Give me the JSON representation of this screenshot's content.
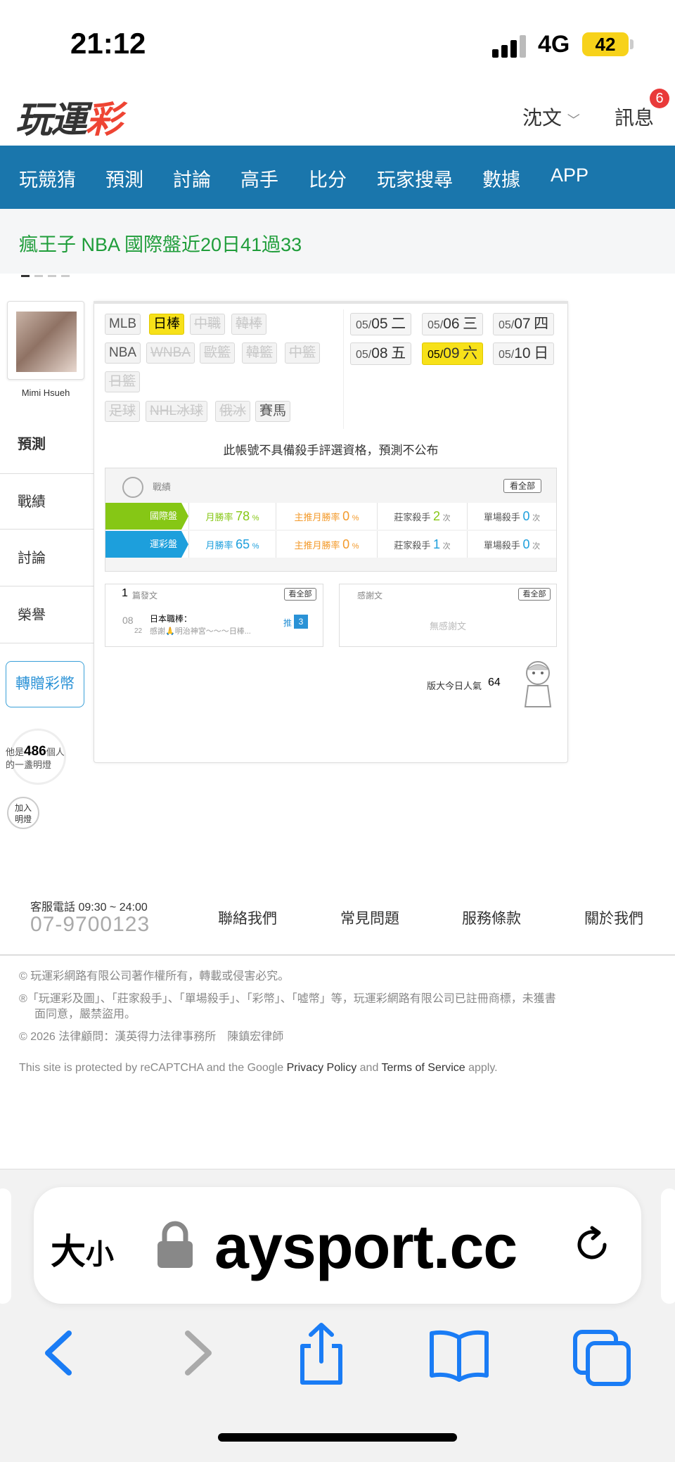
{
  "status": {
    "time": "21:12",
    "network": "4G",
    "battery": "42"
  },
  "header": {
    "logo_main": "玩運",
    "logo_accent": "彩",
    "user": "沈文",
    "messages_label": "訊息",
    "messages_count": "6"
  },
  "nav": {
    "items": [
      "玩競猜",
      "預測",
      "討論",
      "高手",
      "比分",
      "玩家搜尋",
      "數據",
      "APP"
    ]
  },
  "ticker": {
    "text": "瘋王子 NBA 國際盤近20日41過33"
  },
  "profile": {
    "name": "Mimi Hsueh",
    "tabs": [
      "預測",
      "戰績",
      "討論",
      "榮譽"
    ],
    "gift_button": "轉贈彩幣",
    "lamp_prefix": "他是",
    "lamp_count": "486",
    "lamp_suffix": "個人",
    "lamp_line2": "的一盞明燈",
    "join_line1": "加入",
    "join_line2": "明燈"
  },
  "leagues": {
    "row1": [
      {
        "label": "MLB",
        "state": "normal"
      },
      {
        "label": "日棒",
        "state": "on"
      },
      {
        "label": "中職",
        "state": "dis"
      },
      {
        "label": "韓棒",
        "state": "dis"
      }
    ],
    "row2": [
      {
        "label": "NBA",
        "state": "normal"
      },
      {
        "label": "WNBA",
        "state": "dis"
      },
      {
        "label": "歐籃",
        "state": "dis"
      },
      {
        "label": "韓籃",
        "state": "dis"
      },
      {
        "label": "中籃",
        "state": "dis"
      }
    ],
    "row3": [
      {
        "label": "日籃",
        "state": "dis"
      }
    ],
    "row4": [
      {
        "label": "足球",
        "state": "dis"
      },
      {
        "label": "NHL冰球",
        "state": "dis"
      },
      {
        "label": "俄冰",
        "state": "dis"
      },
      {
        "label": "賽馬",
        "state": "normal"
      }
    ]
  },
  "dates": [
    {
      "md": "05/",
      "d": "05",
      "w": "二",
      "on": false
    },
    {
      "md": "05/",
      "d": "06",
      "w": "三",
      "on": false
    },
    {
      "md": "05/",
      "d": "07",
      "w": "四",
      "on": false
    },
    {
      "md": "05/",
      "d": "08",
      "w": "五",
      "on": false
    },
    {
      "md": "05/",
      "d": "09",
      "w": "六",
      "on": true
    },
    {
      "md": "05/",
      "d": "10",
      "w": "日",
      "on": false
    }
  ],
  "notice": "此帳號不具備殺手評選資格，預測不公布",
  "record": {
    "title": "戰績",
    "view_all": "看全部",
    "rows": [
      {
        "label": "國際盤",
        "color": "#86c715",
        "win_label": "月勝率",
        "win_value": "78",
        "win_unit": "%",
        "main_label": "主推月勝率",
        "main_value": "0",
        "main_unit": "%",
        "bank_label": "莊家殺手",
        "bank_value": "2",
        "bank_unit": "次",
        "single_label": "單場殺手",
        "single_value": "0",
        "single_unit": "次"
      },
      {
        "label": "運彩盤",
        "color": "#1d9fdc",
        "win_label": "月勝率",
        "win_value": "65",
        "win_unit": "%",
        "main_label": "主推月勝率",
        "main_value": "0",
        "main_unit": "%",
        "bank_label": "莊家殺手",
        "bank_value": "1",
        "bank_unit": "次",
        "single_label": "單場殺手",
        "single_value": "0",
        "single_unit": "次"
      }
    ]
  },
  "articles": {
    "count": "1",
    "label": "篇發文",
    "view_all": "看全部",
    "item": {
      "month": "08",
      "day": "22",
      "title": "日本職棒：",
      "snippet": "感謝🙏明治神宮～～～日棒...",
      "push_label": "推",
      "push_count": "3"
    }
  },
  "thanks": {
    "label": "感謝文",
    "view_all": "看全部",
    "empty": "無感謝文"
  },
  "popularity": {
    "label": "版大今日人氣",
    "value": "64"
  },
  "footer": {
    "service_label": "客服電話 09:30 ~ 24:00",
    "phone": "07-9700123",
    "links": [
      "聯絡我們",
      "常見問題",
      "服務條款",
      "關於我們"
    ],
    "copyright": "© 玩運彩網路有限公司著作權所有，轉載或侵害必究。",
    "trademark_line1": "®「玩運彩及圖」、「莊家殺手」、「單場殺手」、「彩幣」、「嘘幣」等，玩運彩網路有限公司已註冊商標，未獲書",
    "trademark_line2": "面同意，嚴禁盜用。",
    "lawyer": "© 2026 法律顧問：漢英得力法律事務所　陳鎮宏律師",
    "recaptcha_pre": "This site is protected by reCAPTCHA and the Google ",
    "privacy": "Privacy Policy",
    "and": " and ",
    "terms": "Terms of Service",
    "apply": " apply."
  },
  "browser": {
    "text_size": "大",
    "text_size_small": "小",
    "url": "aysport.cc"
  }
}
